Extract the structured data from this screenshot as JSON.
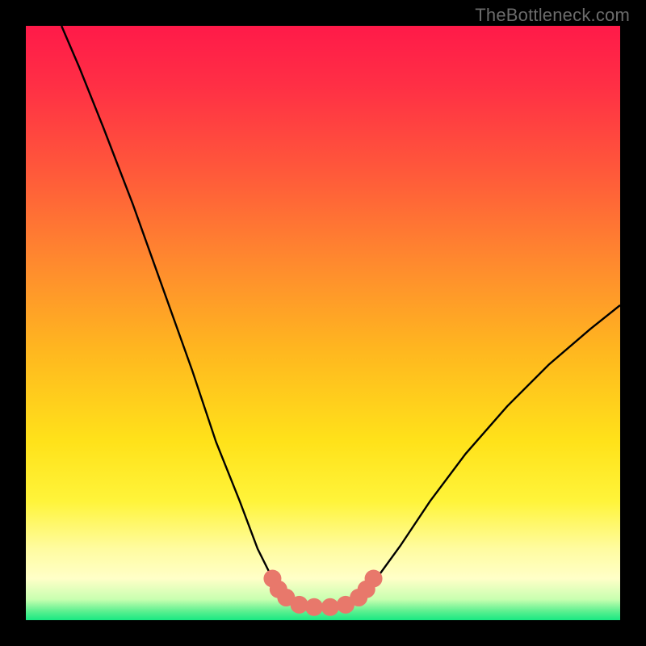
{
  "watermark": "TheBottleneck.com",
  "chart_data": {
    "type": "line",
    "title": "",
    "xlabel": "",
    "ylabel": "",
    "xlim": [
      0,
      100
    ],
    "ylim": [
      0,
      100
    ],
    "background_gradient_stops": [
      {
        "offset": 0.0,
        "color": "#ff1a49"
      },
      {
        "offset": 0.1,
        "color": "#ff2f45"
      },
      {
        "offset": 0.25,
        "color": "#ff5a3a"
      },
      {
        "offset": 0.4,
        "color": "#ff8a2e"
      },
      {
        "offset": 0.55,
        "color": "#ffb81f"
      },
      {
        "offset": 0.7,
        "color": "#ffe21a"
      },
      {
        "offset": 0.8,
        "color": "#fff43a"
      },
      {
        "offset": 0.88,
        "color": "#fffca0"
      },
      {
        "offset": 0.93,
        "color": "#ffffc8"
      },
      {
        "offset": 0.965,
        "color": "#c8ffb0"
      },
      {
        "offset": 0.985,
        "color": "#5cf090"
      },
      {
        "offset": 1.0,
        "color": "#18e882"
      }
    ],
    "series": [
      {
        "name": "bottleneck-curve",
        "color": "#000000",
        "points": [
          {
            "x": 6.0,
            "y": 100.0
          },
          {
            "x": 9.0,
            "y": 93.0
          },
          {
            "x": 13.0,
            "y": 83.0
          },
          {
            "x": 18.0,
            "y": 70.0
          },
          {
            "x": 23.0,
            "y": 56.0
          },
          {
            "x": 28.0,
            "y": 42.0
          },
          {
            "x": 32.0,
            "y": 30.0
          },
          {
            "x": 36.0,
            "y": 20.0
          },
          {
            "x": 39.0,
            "y": 12.0
          },
          {
            "x": 41.5,
            "y": 7.0
          },
          {
            "x": 43.5,
            "y": 4.0
          },
          {
            "x": 46.0,
            "y": 2.5
          },
          {
            "x": 50.0,
            "y": 2.0
          },
          {
            "x": 54.0,
            "y": 2.5
          },
          {
            "x": 56.5,
            "y": 4.0
          },
          {
            "x": 59.0,
            "y": 7.0
          },
          {
            "x": 63.0,
            "y": 12.5
          },
          {
            "x": 68.0,
            "y": 20.0
          },
          {
            "x": 74.0,
            "y": 28.0
          },
          {
            "x": 81.0,
            "y": 36.0
          },
          {
            "x": 88.0,
            "y": 43.0
          },
          {
            "x": 95.0,
            "y": 49.0
          },
          {
            "x": 100.0,
            "y": 53.0
          }
        ]
      }
    ],
    "markers": {
      "name": "highlight-dots",
      "color": "#e8786b",
      "radius": 11,
      "points": [
        {
          "x": 41.5,
          "y": 7.0
        },
        {
          "x": 42.5,
          "y": 5.2
        },
        {
          "x": 43.8,
          "y": 3.8
        },
        {
          "x": 46.0,
          "y": 2.6
        },
        {
          "x": 48.5,
          "y": 2.2
        },
        {
          "x": 51.2,
          "y": 2.2
        },
        {
          "x": 53.8,
          "y": 2.6
        },
        {
          "x": 56.0,
          "y": 3.8
        },
        {
          "x": 57.3,
          "y": 5.2
        },
        {
          "x": 58.5,
          "y": 7.0
        }
      ]
    }
  }
}
